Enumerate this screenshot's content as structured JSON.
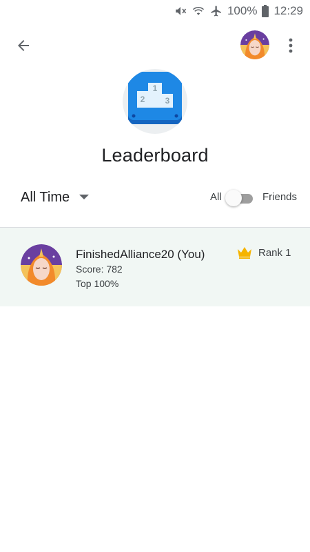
{
  "status_bar": {
    "battery_percent": "100%",
    "time": "12:29",
    "icons": [
      "mute-icon",
      "wifi-icon",
      "airplane-icon",
      "battery-icon"
    ]
  },
  "app_bar": {
    "icons": [
      "back-arrow-icon",
      "player-avatar",
      "more-vert-icon"
    ]
  },
  "header": {
    "icon": "podium-icon",
    "title": "Leaderboard"
  },
  "filters": {
    "time_selected": "All Time",
    "toggle_left_label": "All",
    "toggle_right_label": "Friends",
    "toggle_on": false
  },
  "entries": [
    {
      "name": "FinishedAlliance20 (You)",
      "score": "Score: 782",
      "percentile": "Top 100%",
      "rank": "Rank 1",
      "rank_icon": "crown-icon"
    }
  ],
  "colors": {
    "highlight_row": "#f1f7f4",
    "crown": "#f6b400",
    "podium_blue": "#1e88e5"
  }
}
